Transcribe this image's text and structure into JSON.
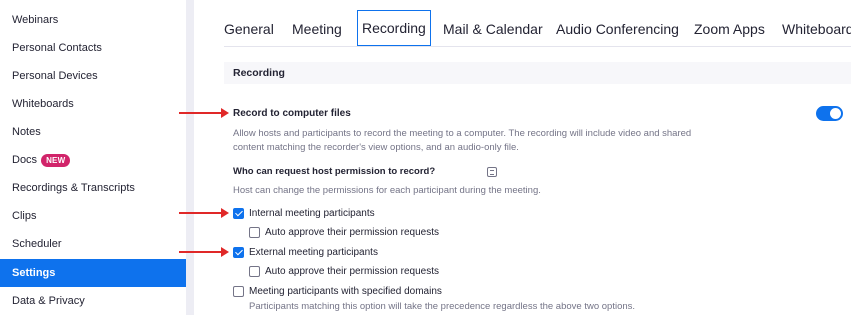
{
  "sidebar": {
    "items": [
      {
        "label": "Webinars"
      },
      {
        "label": "Personal Contacts"
      },
      {
        "label": "Personal Devices"
      },
      {
        "label": "Whiteboards"
      },
      {
        "label": "Notes"
      },
      {
        "label": "Docs",
        "badge": "NEW"
      },
      {
        "label": "Recordings & Transcripts"
      },
      {
        "label": "Clips"
      },
      {
        "label": "Scheduler"
      },
      {
        "label": "Settings",
        "active": true
      },
      {
        "label": "Data & Privacy"
      }
    ]
  },
  "tabs": [
    {
      "label": "General"
    },
    {
      "label": "Meeting"
    },
    {
      "label": "Recording",
      "active": true
    },
    {
      "label": "Mail & Calendar"
    },
    {
      "label": "Audio Conferencing"
    },
    {
      "label": "Zoom Apps"
    },
    {
      "label": "Whiteboard"
    }
  ],
  "section": {
    "title": "Recording"
  },
  "record_to_computer": {
    "title": "Record to computer files",
    "description": "Allow hosts and participants to record the meeting to a computer. The recording will include video and shared content matching the recorder's view options, and an audio-only file.",
    "enabled": true
  },
  "host_permission": {
    "title": "Who can request host permission to record?",
    "description": "Host can change the permissions for each participant during the meeting."
  },
  "options": [
    {
      "label": "Internal meeting participants",
      "checked": true
    },
    {
      "label": "Auto approve their permission requests",
      "checked": false
    },
    {
      "label": "External meeting participants",
      "checked": true
    },
    {
      "label": "Auto approve their permission requests",
      "checked": false
    },
    {
      "label": "Meeting participants with specified domains",
      "checked": false
    }
  ],
  "domains_note": "Participants matching this option will take the precedence regardless the above two options.",
  "colors": {
    "accent": "#0e72ed",
    "new_badge": "#d1246a",
    "annotation_arrow": "#e02828"
  }
}
